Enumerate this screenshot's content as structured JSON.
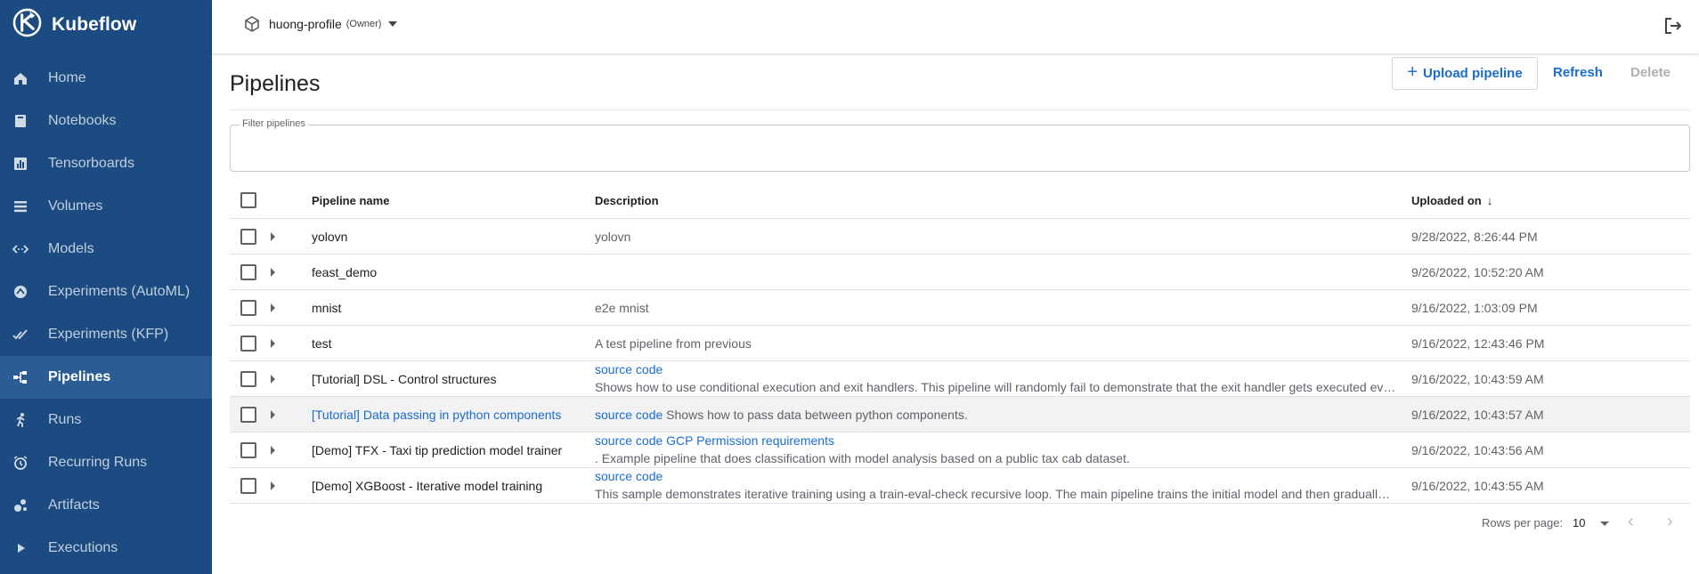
{
  "brand": {
    "name": "Kubeflow"
  },
  "sidebar": {
    "items": [
      {
        "label": "Home",
        "icon": "home-icon"
      },
      {
        "label": "Notebooks",
        "icon": "notebook-icon"
      },
      {
        "label": "Tensorboards",
        "icon": "chart-icon"
      },
      {
        "label": "Volumes",
        "icon": "list-icon"
      },
      {
        "label": "Models",
        "icon": "code-arrows-icon"
      },
      {
        "label": "Experiments (AutoML)",
        "icon": "automl-icon"
      },
      {
        "label": "Experiments (KFP)",
        "icon": "checks-icon"
      },
      {
        "label": "Pipelines",
        "icon": "pipeline-icon",
        "active": true
      },
      {
        "label": "Runs",
        "icon": "runner-icon"
      },
      {
        "label": "Recurring Runs",
        "icon": "alarm-icon"
      },
      {
        "label": "Artifacts",
        "icon": "bubbles-icon"
      },
      {
        "label": "Executions",
        "icon": "play-icon"
      }
    ]
  },
  "topbar": {
    "namespace": "huong-profile",
    "role": "(Owner)"
  },
  "page": {
    "title": "Pipelines"
  },
  "toolbar": {
    "upload_label": "Upload pipeline",
    "refresh_label": "Refresh",
    "delete_label": "Delete"
  },
  "filter": {
    "label": "Filter pipelines",
    "value": ""
  },
  "table": {
    "headers": {
      "name": "Pipeline name",
      "description": "Description",
      "uploaded": "Uploaded on"
    },
    "rows": [
      {
        "name": "yolovn",
        "desc_plain": "yolovn",
        "uploaded": "9/28/2022, 8:26:44 PM"
      },
      {
        "name": "feast_demo",
        "desc_plain": "",
        "uploaded": "9/26/2022, 10:52:20 AM"
      },
      {
        "name": "mnist",
        "desc_plain": "e2e mnist",
        "uploaded": "9/16/2022, 1:03:09 PM"
      },
      {
        "name": "test",
        "desc_plain": "A test pipeline from previous",
        "uploaded": "9/16/2022, 12:43:46 PM"
      },
      {
        "name": "[Tutorial] DSL - Control structures",
        "desc_link": "source code",
        "desc_text": "Shows how to use conditional execution and exit handlers. This pipeline will randomly fail to demonstrate that the exit handler gets executed even in case of failure.",
        "uploaded": "9/16/2022, 10:43:59 AM"
      },
      {
        "name": "[Tutorial] Data passing in python components",
        "desc_link": "source code",
        "desc_text": " Shows how to pass data between python components.",
        "uploaded": "9/16/2022, 10:43:57 AM"
      },
      {
        "name": "[Demo] TFX - Taxi tip prediction model trainer",
        "desc_link": "source code GCP Permission requirements",
        "desc_text": ". Example pipeline that does classification with model analysis based on a public tax cab dataset.",
        "uploaded": "9/16/2022, 10:43:56 AM"
      },
      {
        "name": "[Demo] XGBoost - Iterative model training",
        "desc_link": "source code",
        "desc_text": "This sample demonstrates iterative training using a train-eval-check recursive loop. The main pipeline trains the initial model and then gradually trains the model some more until the model evaluation metrics are good enough.",
        "uploaded": "9/16/2022, 10:43:55 AM"
      }
    ]
  },
  "pagination": {
    "rows_label": "Rows per page:",
    "rows_value": "10"
  },
  "colors": {
    "sidebar": "#1b4b80",
    "sidebar_active": "#2b5d94",
    "accent": "#1a6dcc"
  }
}
